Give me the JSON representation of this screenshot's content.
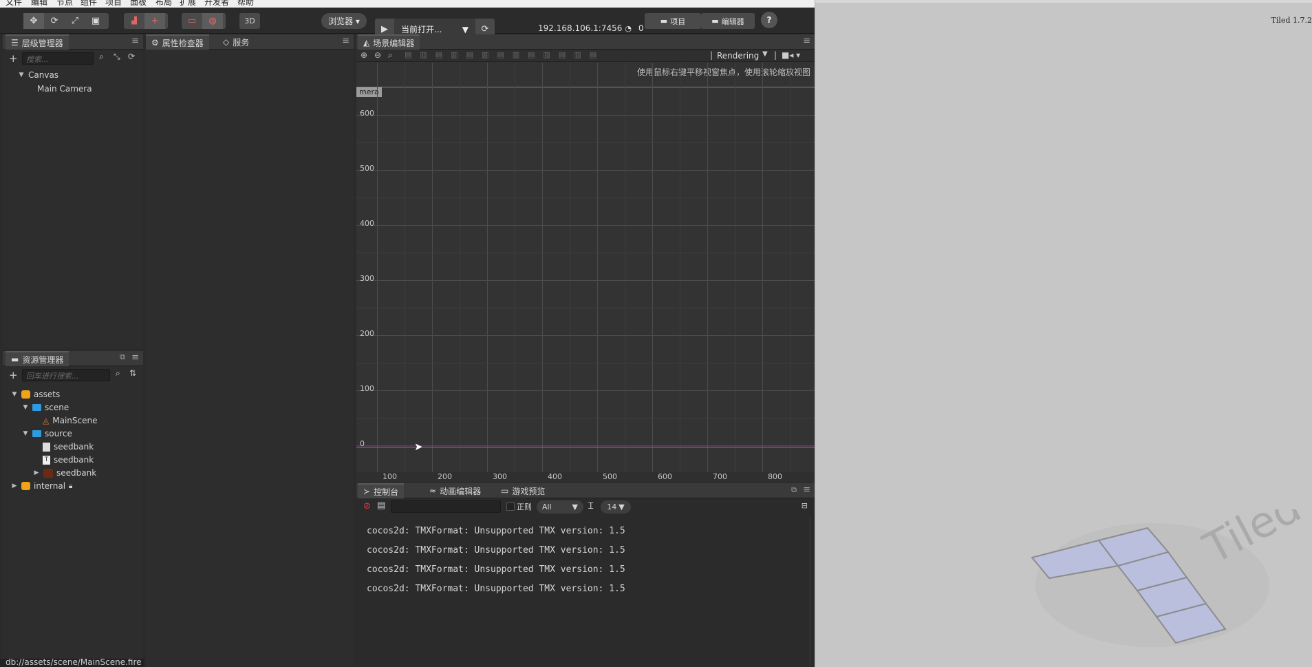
{
  "menubar": {
    "items": [
      "文件",
      "编辑",
      "节点",
      "组件",
      "项目",
      "面板",
      "布局",
      "扩展",
      "开发者",
      "帮助"
    ]
  },
  "toolbar": {
    "transform_icons": [
      "move-icon",
      "rotate-icon",
      "scale-icon",
      "rect-icon"
    ],
    "pivot_icons": [
      "pivot-icon",
      "anchor-icon"
    ],
    "coord_icons": [
      "local-icon",
      "global-icon"
    ],
    "mode_3d": "3D",
    "browser_label": "浏览器 ▾",
    "play_icon": "play-icon",
    "scene_select": "当前打开...",
    "scene_select_arrow": "▼",
    "refresh_icon": "refresh-icon",
    "ip": "192.168.106.1:7456",
    "wifi_icon": "wifi-icon",
    "device_count": "0",
    "project_button": "项目",
    "editor_button": "编辑器",
    "help_icon": "?"
  },
  "hierarchy": {
    "tab": "层级管理器",
    "search_placeholder": "搜索...",
    "nodes": [
      {
        "label": "Canvas",
        "expanded": true
      },
      {
        "label": "Main Camera"
      }
    ]
  },
  "inspector": {
    "tabs": [
      "属性检查器",
      "服务"
    ]
  },
  "assets": {
    "tab": "资源管理器",
    "search_placeholder": "回车进行搜索...",
    "items": [
      {
        "label": "assets",
        "icon": "db-icon"
      },
      {
        "label": "scene",
        "icon": "folder-icon"
      },
      {
        "label": "MainScene",
        "icon": "fire-icon"
      },
      {
        "label": "source",
        "icon": "folder-icon"
      },
      {
        "label": "seedbank",
        "icon": "text-file-icon"
      },
      {
        "label": "seedbank",
        "icon": "tiled-map-icon"
      },
      {
        "label": "seedbank",
        "icon": "image-icon"
      },
      {
        "label": "internal",
        "icon": "db-icon",
        "locked": true
      }
    ]
  },
  "status": {
    "path": "db://assets/scene/MainScene.fire"
  },
  "scene_editor": {
    "tab": "场景编辑器",
    "hint": "使用鼠标右键平移视窗焦点，使用滚轮缩放视图",
    "camera_label": "mera",
    "render_select": "Rendering",
    "y_labels": [
      "600",
      "500",
      "400",
      "300",
      "200",
      "100",
      "0"
    ],
    "x_labels": [
      "100",
      "200",
      "300",
      "400",
      "500",
      "600",
      "700",
      "800"
    ]
  },
  "console": {
    "tabs": [
      "控制台",
      "动画编辑器",
      "游戏预览"
    ],
    "regex_label": "正则",
    "filter_select": "All",
    "font_size": "14",
    "lines": [
      "cocos2d: TMXFormat: Unsupported TMX version: 1.5",
      "cocos2d: TMXFormat: Unsupported TMX version: 1.5",
      "cocos2d: TMXFormat: Unsupported TMX version: 1.5",
      "cocos2d: TMXFormat: Unsupported TMX version: 1.5"
    ]
  },
  "tiled": {
    "version": "Tiled 1.7.2",
    "logo_text": "Tiled"
  },
  "colors": {
    "accent_pink": "#e05ad0",
    "folder_blue": "#2f9ae0",
    "db_orange": "#f0a31a"
  }
}
